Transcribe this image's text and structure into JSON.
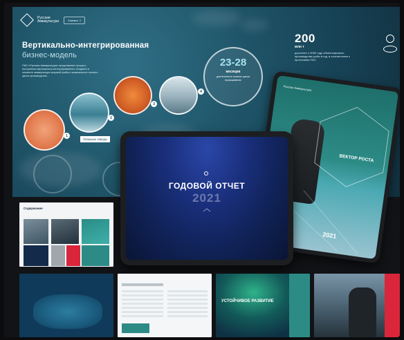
{
  "hero": {
    "logo_text": "Русская Аквакультура",
    "lang_label": "Скачать ⇩",
    "title": "Вертикально-интегрированная",
    "subtitle": "бизнес-модель",
    "description": "ПАО «Русская Аквакультура» представляет процесс построения вертикально-интегрированного холдинга в сегменте аквакультуры морской рыбы и возможности полного цикла производства...",
    "step_label": "Овощные заводы",
    "steps": [
      "1",
      "2",
      "3",
      "4"
    ],
    "cycle_value": "23-28",
    "cycle_unit": "месяцев",
    "cycle_desc": "длительность полного цикла выращивания",
    "stat_value": "200",
    "stat_unit": "млн т",
    "stat_desc": "достигнет к 2050 году объем мирового производства рыбы в год, в соответствии с прогнозами FAO"
  },
  "back_tablet": {
    "logo_text": "Русская Аквакультура",
    "slogan": "ВЕКТОР РОСТА",
    "year": "2021"
  },
  "front_tablet": {
    "title": "ГОДОВОЙ ОТЧЕТ",
    "year": "2021"
  },
  "thumbs": {
    "t1_heading": "Содержание",
    "t4_title": "УСТОЙЧИВОЕ РАЗВИТИЕ"
  },
  "colors": {
    "accent_teal": "#2d8b86",
    "accent_red": "#d9263a",
    "navy": "#102257"
  }
}
